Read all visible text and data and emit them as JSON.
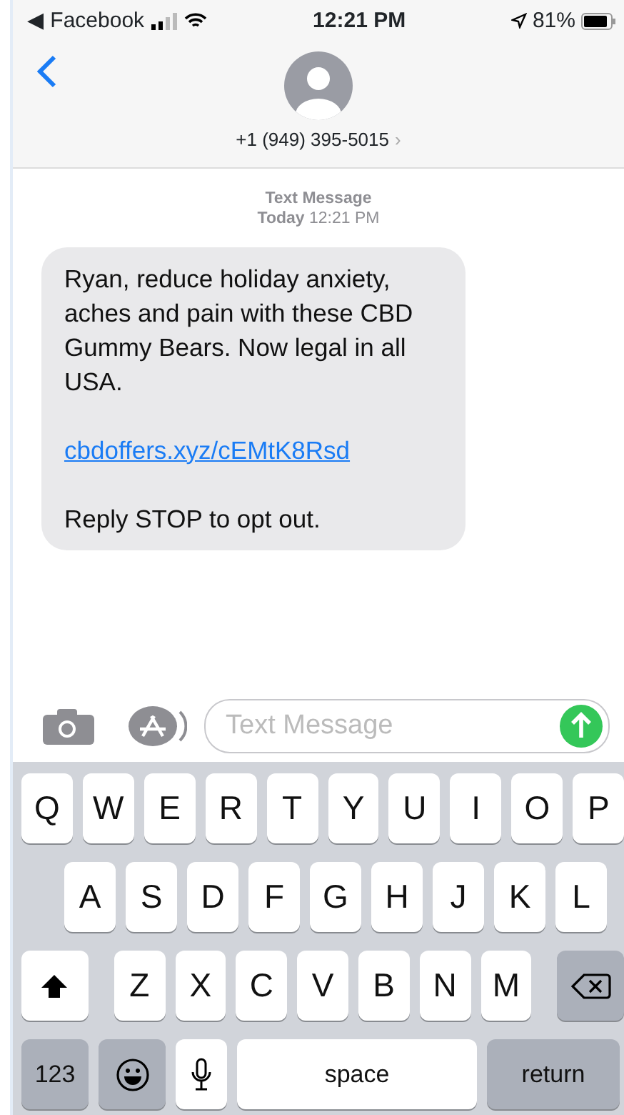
{
  "status_bar": {
    "back_app": "◀ Facebook",
    "time": "12:21 PM",
    "battery": "81%"
  },
  "header": {
    "contact": "+1 (949) 395-5015",
    "chevron": "›"
  },
  "thread": {
    "service": "Text Message",
    "day": "Today",
    "time": "12:21 PM",
    "messages": [
      {
        "parts": [
          {
            "kind": "text",
            "text": "Ryan, reduce holiday anxiety, aches and pain with these CBD Gummy Bears. Now legal in all USA."
          },
          {
            "kind": "link",
            "text": "cbdoffers.xyz/cEMtK8Rsd"
          },
          {
            "kind": "text",
            "text": "Reply STOP to opt out."
          }
        ]
      }
    ]
  },
  "composer": {
    "placeholder": "Text Message"
  },
  "keyboard": [
    [
      {
        "kind": "letter",
        "label": "Q"
      },
      {
        "kind": "letter",
        "label": "W"
      },
      {
        "kind": "letter",
        "label": "E"
      },
      {
        "kind": "letter",
        "label": "R"
      },
      {
        "kind": "letter",
        "label": "T"
      },
      {
        "kind": "letter",
        "label": "Y"
      },
      {
        "kind": "letter",
        "label": "U"
      },
      {
        "kind": "letter",
        "label": "I"
      },
      {
        "kind": "letter",
        "label": "O"
      },
      {
        "kind": "letter",
        "label": "P"
      }
    ],
    [
      {
        "kind": "letter",
        "label": "A"
      },
      {
        "kind": "letter",
        "label": "S"
      },
      {
        "kind": "letter",
        "label": "D"
      },
      {
        "kind": "letter",
        "label": "F"
      },
      {
        "kind": "letter",
        "label": "G"
      },
      {
        "kind": "letter",
        "label": "H"
      },
      {
        "kind": "letter",
        "label": "J"
      },
      {
        "kind": "letter",
        "label": "K"
      },
      {
        "kind": "letter",
        "label": "L"
      }
    ],
    [
      {
        "kind": "shift"
      },
      {
        "kind": "letter",
        "label": "Z"
      },
      {
        "kind": "letter",
        "label": "X"
      },
      {
        "kind": "letter",
        "label": "C"
      },
      {
        "kind": "letter",
        "label": "V"
      },
      {
        "kind": "letter",
        "label": "B"
      },
      {
        "kind": "letter",
        "label": "N"
      },
      {
        "kind": "letter",
        "label": "M"
      },
      {
        "kind": "delete"
      }
    ],
    [
      {
        "kind": "numbers",
        "label": "123"
      },
      {
        "kind": "emoji"
      },
      {
        "kind": "mic"
      },
      {
        "kind": "space",
        "label": "space"
      },
      {
        "kind": "return",
        "label": "return"
      }
    ]
  ]
}
